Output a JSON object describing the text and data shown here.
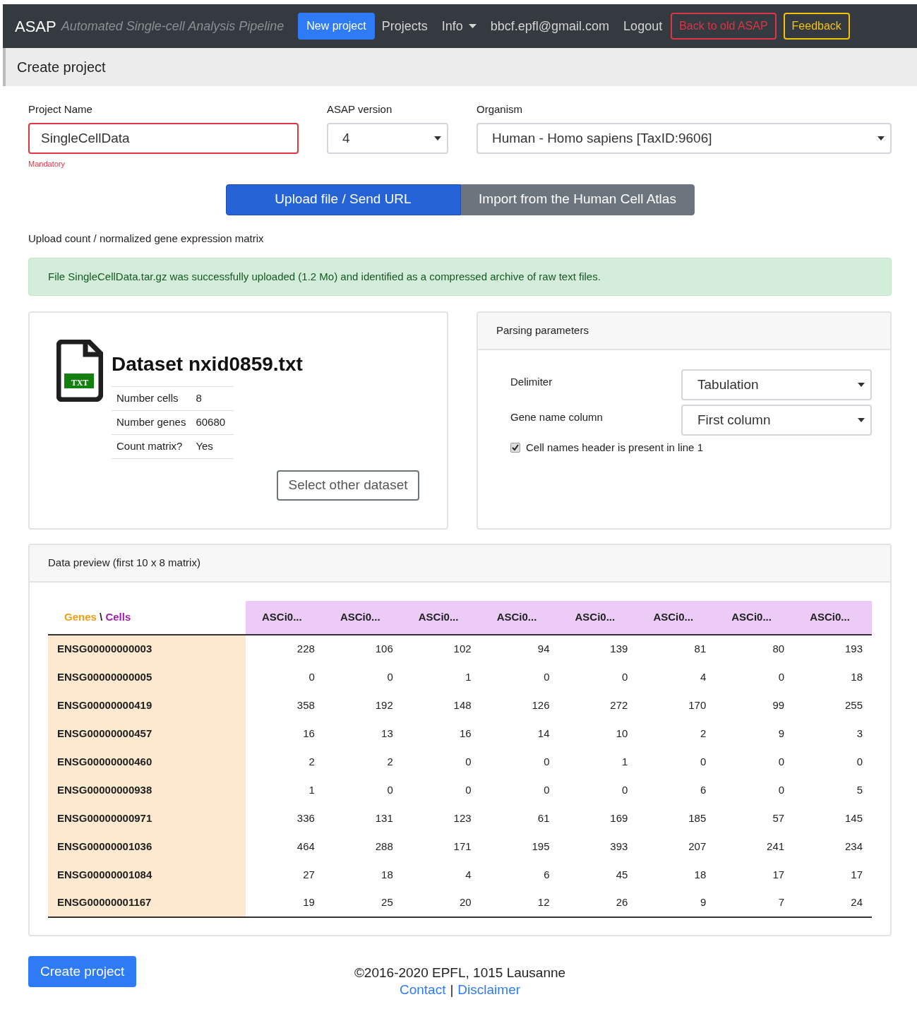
{
  "navbar": {
    "brand": "ASAP",
    "tagline": "Automated Single-cell Analysis Pipeline",
    "items": [
      {
        "kind": "primary",
        "label": "New project"
      },
      {
        "kind": "link",
        "label": "Projects"
      },
      {
        "kind": "dropdown",
        "label": "Info"
      },
      {
        "kind": "link",
        "label": "bbcf.epfl@gmail.com"
      },
      {
        "kind": "link",
        "label": "Logout"
      },
      {
        "kind": "danger",
        "label": "Back to old ASAP"
      },
      {
        "kind": "warning",
        "label": "Feedback"
      }
    ]
  },
  "breadcrumb": "Create project",
  "form": {
    "project_name": {
      "label": "Project Name",
      "value": "SingleCellData",
      "hint": "Mandatory"
    },
    "version": {
      "label": "ASAP version",
      "value": "4"
    },
    "organism": {
      "label": "Organism",
      "value": "Human - Homo sapiens [TaxID:9606]"
    }
  },
  "tabs": [
    {
      "label": "Upload file / Send URL",
      "selected": true
    },
    {
      "label": "Import from the Human Cell Atlas",
      "selected": false
    }
  ],
  "upload_label": "Upload count / normalized gene expression matrix",
  "alert": "File SingleCellData.tar.gz was successfully uploaded (1.2 Mo) and identified as a compressed archive of raw text files.",
  "dataset": {
    "file_badge": "TXT",
    "title": "Dataset nxid0859.txt",
    "stats": [
      {
        "label": "Number cells",
        "value": "8"
      },
      {
        "label": "Number genes",
        "value": "60680"
      },
      {
        "label": "Count matrix?",
        "value": "Yes"
      }
    ],
    "button": "Select other dataset"
  },
  "parsing": {
    "title": "Parsing parameters",
    "fields": [
      {
        "label": "Delimiter",
        "value": "Tabulation"
      },
      {
        "label": "Gene name column",
        "value": "First column"
      }
    ],
    "header_checkbox": {
      "label": "Cell names header is present in line 1",
      "checked": true
    }
  },
  "preview": {
    "title": "Data preview (first 10 x 8 matrix)",
    "corner": {
      "rows_label": "Genes",
      "separator": "\\",
      "cols_label": "Cells"
    },
    "columns": [
      "ASCi0...",
      "ASCi0...",
      "ASCi0...",
      "ASCi0...",
      "ASCi0...",
      "ASCi0...",
      "ASCi0...",
      "ASCi0..."
    ],
    "rows": [
      {
        "gene": "ENSG00000000003",
        "values": [
          "228",
          "106",
          "102",
          "94",
          "139",
          "81",
          "80",
          "193"
        ]
      },
      {
        "gene": "ENSG00000000005",
        "values": [
          "0",
          "0",
          "1",
          "0",
          "0",
          "4",
          "0",
          "18"
        ]
      },
      {
        "gene": "ENSG00000000419",
        "values": [
          "358",
          "192",
          "148",
          "126",
          "272",
          "170",
          "99",
          "255"
        ]
      },
      {
        "gene": "ENSG00000000457",
        "values": [
          "16",
          "13",
          "16",
          "14",
          "10",
          "2",
          "9",
          "3"
        ]
      },
      {
        "gene": "ENSG00000000460",
        "values": [
          "2",
          "2",
          "0",
          "0",
          "1",
          "0",
          "0",
          "0"
        ]
      },
      {
        "gene": "ENSG00000000938",
        "values": [
          "1",
          "0",
          "0",
          "0",
          "0",
          "6",
          "0",
          "5"
        ]
      },
      {
        "gene": "ENSG00000000971",
        "values": [
          "336",
          "131",
          "123",
          "61",
          "169",
          "185",
          "57",
          "145"
        ]
      },
      {
        "gene": "ENSG00000001036",
        "values": [
          "464",
          "288",
          "171",
          "195",
          "393",
          "207",
          "241",
          "234"
        ]
      },
      {
        "gene": "ENSG00000001084",
        "values": [
          "27",
          "18",
          "4",
          "6",
          "45",
          "18",
          "17",
          "17"
        ]
      },
      {
        "gene": "ENSG00000001167",
        "values": [
          "19",
          "25",
          "20",
          "12",
          "26",
          "9",
          "7",
          "24"
        ]
      }
    ]
  },
  "submit": "Create project",
  "footer": {
    "copyright": "©2016-2020 EPFL, 1015 Lausanne",
    "links": [
      "Contact",
      "Disclaimer"
    ],
    "separator": "|"
  }
}
